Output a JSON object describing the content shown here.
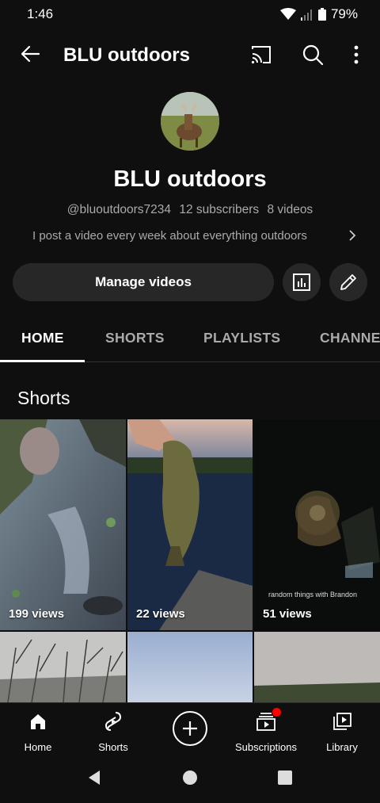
{
  "status": {
    "time": "1:46",
    "battery": "79%"
  },
  "app_bar": {
    "title": "BLU outdoors"
  },
  "channel": {
    "name": "BLU outdoors",
    "handle": "@bluoutdoors7234",
    "subscribers": "12 subscribers",
    "videos": "8 videos",
    "description": "I post a video every week about everything outdoors"
  },
  "actions": {
    "manage_label": "Manage videos"
  },
  "tabs": [
    "HOME",
    "SHORTS",
    "PLAYLISTS",
    "CHANNELS"
  ],
  "section": {
    "title": "Shorts"
  },
  "shorts": [
    {
      "views": "199 views"
    },
    {
      "views": "22 views"
    },
    {
      "views": "51 views",
      "overlay": "random things with Brandon"
    }
  ],
  "nav": {
    "home": "Home",
    "shorts": "Shorts",
    "subscriptions": "Subscriptions",
    "library": "Library"
  },
  "colors": {
    "background": "#0f0f0f",
    "button": "#272727",
    "notification": "#ff0000"
  }
}
